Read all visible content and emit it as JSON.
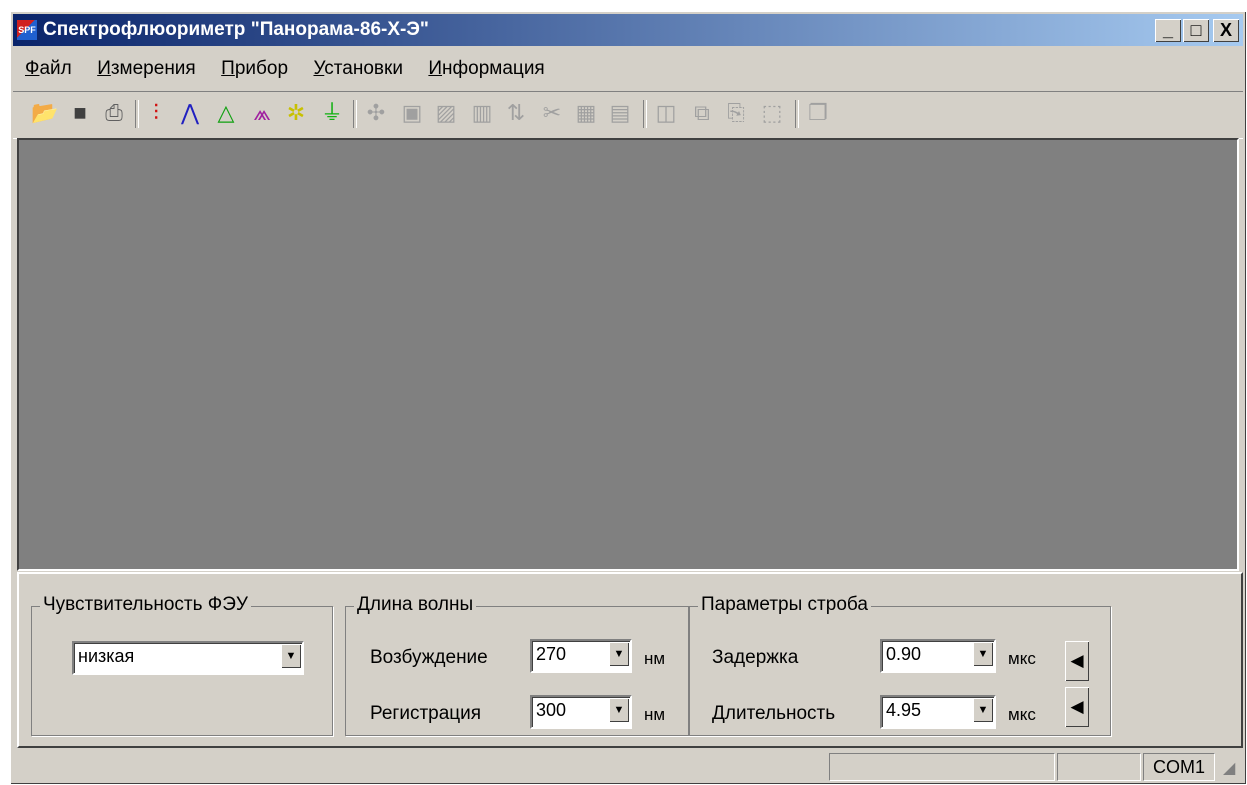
{
  "window": {
    "title": "Спектрофлюориметр \"Панорама-86-Х-Э\"",
    "icon": "SPF"
  },
  "title_buttons": {
    "minimize": "_",
    "maximize": "□",
    "close": "X"
  },
  "menu": [
    {
      "hot": "Ф",
      "rest": "айл"
    },
    {
      "hot": "И",
      "rest": "змерения"
    },
    {
      "hot": "П",
      "rest": "рибор"
    },
    {
      "hot": "У",
      "rest": "становки"
    },
    {
      "hot": "И",
      "rest": "нформация"
    }
  ],
  "toolbar": {
    "icons": [
      "open-icon",
      "save-icon",
      "print-icon",
      "spectrum-icon",
      "excitation-icon",
      "emission-icon",
      "peaks-icon",
      "lamp-icon",
      "detector-icon",
      "smooth-icon",
      "zoom-icon",
      "baseline-icon",
      "bars-icon",
      "sort-icon",
      "cross-icon",
      "grid-icon",
      "table-icon",
      "chart-icon",
      "copy-icon",
      "paste-icon",
      "export-icon",
      "windows-icon"
    ]
  },
  "panel": {
    "pmt_group": {
      "title": "Чувствительность ФЭУ",
      "value": "низкая"
    },
    "wavelength_group": {
      "title": "Длина волны",
      "excitation_label": "Возбуждение",
      "excitation_value": "270",
      "excitation_unit": "нм",
      "registration_label": "Регистрация",
      "registration_value": "300",
      "registration_unit": "нм"
    },
    "gate_group": {
      "title": "Параметры строба",
      "delay_label": "Задержка",
      "delay_value": "0.90",
      "delay_unit": "мкс",
      "duration_label": "Длительность",
      "duration_value": "4.95",
      "duration_unit": "мкс"
    }
  },
  "status": {
    "port": "COM1"
  }
}
